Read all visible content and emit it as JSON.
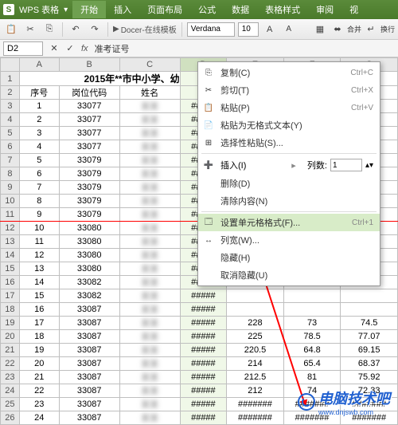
{
  "app": {
    "name": "WPS 表格",
    "dropdown": "▾"
  },
  "ribbon_tabs": [
    "开始",
    "插入",
    "页面布局",
    "公式",
    "数据",
    "表格样式",
    "审阅",
    "视"
  ],
  "active_tab": 0,
  "toolbar": {
    "docer": "Docer-在线模板",
    "font_name": "Verdana",
    "font_size": "10",
    "merge_label": "合并",
    "wrap_label": "换行"
  },
  "namebox": {
    "ref": "D2",
    "fx": "fx",
    "value": "准考证号"
  },
  "columns": [
    "A",
    "B",
    "C",
    "D",
    "E",
    "F",
    "G"
  ],
  "selected_col": 3,
  "title_row": "2015年**市中小学、幼",
  "headers": [
    "序号",
    "岗位代码",
    "姓名",
    "准"
  ],
  "rows": [
    {
      "n": 1,
      "code": 33077,
      "d": "#####",
      "e": "",
      "f": "",
      "g": ""
    },
    {
      "n": 2,
      "code": 33077,
      "d": "#####",
      "e": "",
      "f": "",
      "g": ""
    },
    {
      "n": 3,
      "code": 33077,
      "d": "#####",
      "e": "",
      "f": "",
      "g": ""
    },
    {
      "n": 4,
      "code": 33077,
      "d": "#####",
      "e": "",
      "f": "",
      "g": ""
    },
    {
      "n": 5,
      "code": 33079,
      "d": "#####",
      "e": "",
      "f": "",
      "g": ""
    },
    {
      "n": 6,
      "code": 33079,
      "d": "#####",
      "e": "",
      "f": "",
      "g": ""
    },
    {
      "n": 7,
      "code": 33079,
      "d": "#####",
      "e": "",
      "f": "",
      "g": ""
    },
    {
      "n": 8,
      "code": 33079,
      "d": "#####",
      "e": "",
      "f": "",
      "g": ""
    },
    {
      "n": 9,
      "code": 33079,
      "d": "#####",
      "e": "",
      "f": "",
      "g": ""
    },
    {
      "n": 10,
      "code": 33080,
      "d": "#####",
      "e": "",
      "f": "",
      "g": ""
    },
    {
      "n": 11,
      "code": 33080,
      "d": "#####",
      "e": "",
      "f": "",
      "g": ""
    },
    {
      "n": 12,
      "code": 33080,
      "d": "#####",
      "e": "",
      "f": "",
      "g": ""
    },
    {
      "n": 13,
      "code": 33080,
      "d": "#####",
      "e": "",
      "f": "",
      "g": ""
    },
    {
      "n": 14,
      "code": 33082,
      "d": "#####",
      "e": "",
      "f": "",
      "g": ""
    },
    {
      "n": 15,
      "code": 33082,
      "d": "#####",
      "e": "",
      "f": "",
      "g": ""
    },
    {
      "n": 16,
      "code": 33087,
      "d": "#####",
      "e": "",
      "f": "",
      "g": ""
    },
    {
      "n": 17,
      "code": 33087,
      "d": "#####",
      "e": "228",
      "f": "73",
      "g": "74.5"
    },
    {
      "n": 18,
      "code": 33087,
      "d": "#####",
      "e": "225",
      "f": "78.5",
      "g": "77.07"
    },
    {
      "n": 19,
      "code": 33087,
      "d": "#####",
      "e": "220.5",
      "f": "64.8",
      "g": "69.15"
    },
    {
      "n": 20,
      "code": 33087,
      "d": "#####",
      "e": "214",
      "f": "65.4",
      "g": "68.37"
    },
    {
      "n": 21,
      "code": 33087,
      "d": "#####",
      "e": "212.5",
      "f": "81",
      "g": "75.92"
    },
    {
      "n": 22,
      "code": 33087,
      "d": "#####",
      "e": "212",
      "f": "74",
      "g": "72.33"
    },
    {
      "n": 23,
      "code": 33087,
      "d": "#####",
      "e": "#######",
      "f": "#######",
      "g": "#######"
    },
    {
      "n": 24,
      "code": 33087,
      "d": "#####",
      "e": "#######",
      "f": "#######",
      "g": "#######"
    }
  ],
  "context_menu": {
    "copy": "复制(C)",
    "copy_sc": "Ctrl+C",
    "cut": "剪切(T)",
    "cut_sc": "Ctrl+X",
    "paste": "粘贴(P)",
    "paste_sc": "Ctrl+V",
    "paste_text": "粘贴为无格式文本(Y)",
    "paste_special": "选择性粘贴(S)...",
    "insert": "插入(I)",
    "cols_label": "列数:",
    "cols_value": "1",
    "delete": "删除(D)",
    "clear": "清除内容(N)",
    "format": "设置单元格格式(F)...",
    "format_sc": "Ctrl+1",
    "colwidth": "列宽(W)...",
    "hide": "隐藏(H)",
    "unhide": "取消隐藏(U)"
  },
  "watermark": "电脑技术吧",
  "watermark_url": "www.dnjswb.com"
}
